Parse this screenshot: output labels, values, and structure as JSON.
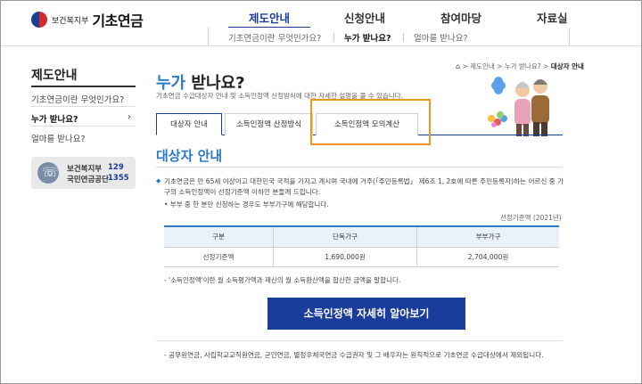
{
  "header": {
    "ministry": "보건복지부",
    "title": "기초연금",
    "gnb": [
      "제도안내",
      "신청안내",
      "참여마당",
      "자료실"
    ],
    "subnav": [
      "기초연금이란 무엇인가요?",
      "누가 받나요?",
      "얼마를 받나요?"
    ]
  },
  "sidebar": {
    "title": "제도안내",
    "items": [
      "기초연금이란 무엇인가요?",
      "누가 받나요?",
      "얼마를 받나요?"
    ],
    "chevron": "›",
    "contacts": [
      {
        "name": "보건복지부",
        "number": "129"
      },
      {
        "name": "국민연금공단",
        "number": "1355"
      }
    ]
  },
  "breadcrumb": {
    "home": "⌂",
    "items": [
      "제도안내",
      "누가 받나요?"
    ],
    "current": "대상자 안내",
    "sep": ">"
  },
  "page": {
    "title_em": "누가",
    "title_rest": "받나요?",
    "desc": "기초연금 수급대상자 안내 및 소득인정액 산정방식에 대한 자세한 설명을 볼 수 있습니다."
  },
  "tabs": [
    "대상자 안내",
    "소득인정액 산정방식",
    "소득인정액 모의계산"
  ],
  "section": {
    "title": "대상자 안내",
    "para": "기초연금은 만 65세 이상이고 대한민국 국적을 가지고 계시며 국내에 거주(「주민등록법」 제6조 1, 2호에 따른 주민등록자)하는 어르신 중 가구의 소득인정액이 선정기준액 이하인 분들께 드립니다.",
    "note1": "• 부부 중 한 분만 신청하는 경우도 부부가구에 해당합니다.",
    "caption": "선정기준액 (2021년)",
    "table": {
      "headers": [
        "구분",
        "단독가구",
        "부부가구"
      ],
      "row": [
        "선정기준액",
        "1,690,000원",
        "2,704,000원"
      ]
    },
    "note2": "- '소득인정액'이란 월 소득평가액과 재산의 월 소득환산액을 합산한 금액을 말합니다.",
    "cta": "소득인정액 자세히 알아보기",
    "note3": "- 공무원연금, 사립학교교직원연금, 군인연금, 별정우체국연금 수급권자 및 그 배우자는 원칙적으로 기초연금 수급대상에서 제외됩니다."
  },
  "colors": {
    "primary": "#1a3d9c",
    "accent": "#2b79c8",
    "highlight": "#f0961e"
  }
}
